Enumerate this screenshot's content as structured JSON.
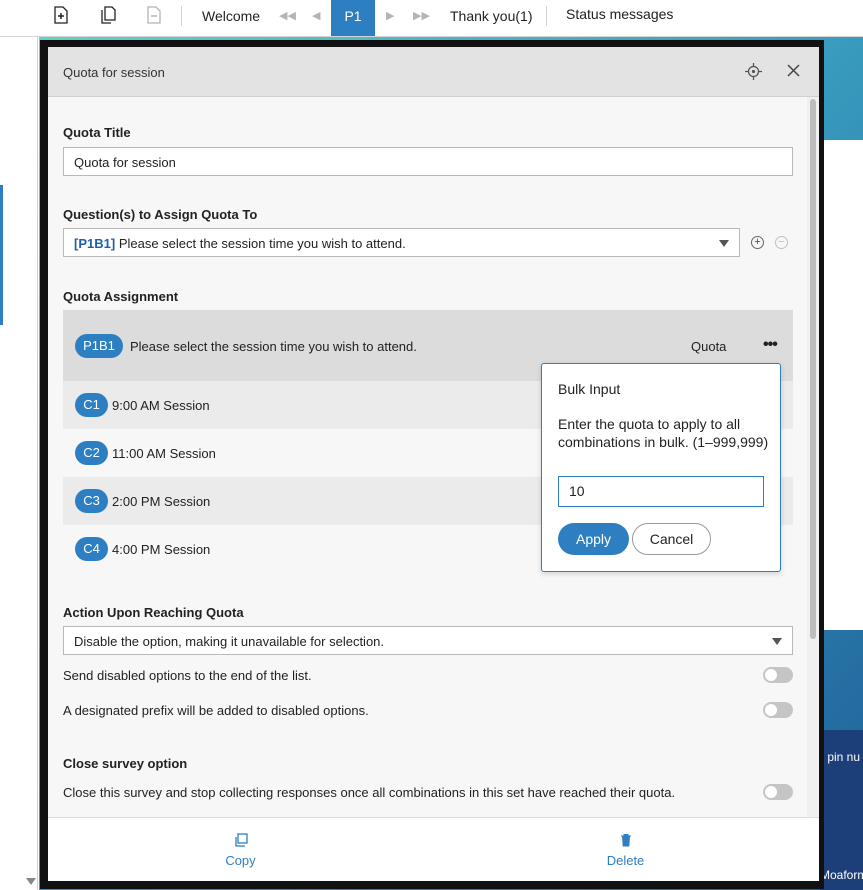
{
  "toolbar": {
    "welcome_label": "Welcome",
    "current_page": "P1",
    "thankyou_label": "Thank you(1)",
    "status_label": "Status messages"
  },
  "background": {
    "text1": "r pin nu",
    "text2": "Moaform"
  },
  "modal": {
    "title": "Quota for session",
    "quota_title_label": "Quota Title",
    "quota_title_value": "Quota for session",
    "questions_label": "Question(s) to Assign Quota To",
    "question_select": {
      "code": "[P1B1]",
      "text": "Please select the session time you wish to attend."
    },
    "assignment_label": "Quota Assignment",
    "assignment_header": {
      "code": "P1B1",
      "text": "Please select the session time you wish to attend.",
      "quota_label": "Quota",
      "more_label": "•••"
    },
    "choices": [
      {
        "code": "C1",
        "label": "9:00 AM Session"
      },
      {
        "code": "C2",
        "label": "11:00 AM Session"
      },
      {
        "code": "C3",
        "label": "2:00 PM Session"
      },
      {
        "code": "C4",
        "label": "4:00 PM Session"
      }
    ],
    "action_label": "Action Upon Reaching Quota",
    "action_value": "Disable the option, making it unavailable for selection.",
    "options": [
      {
        "text": "Send disabled options to the end of the list.",
        "enabled": false
      },
      {
        "text": "A designated prefix will be added to disabled options.",
        "enabled": false
      }
    ],
    "close_label": "Close survey option",
    "close_option": {
      "text": "Close this survey and stop collecting responses once all combinations in this set have reached their quota.",
      "enabled": false
    },
    "footer": {
      "copy_label": "Copy",
      "delete_label": "Delete"
    }
  },
  "bulk_input": {
    "title": "Bulk Input",
    "description": "Enter the quota to apply to all combinations in bulk. (1–999,999)",
    "value": "10",
    "apply_label": "Apply",
    "cancel_label": "Cancel"
  },
  "colors": {
    "accent": "#2e7fc1"
  }
}
